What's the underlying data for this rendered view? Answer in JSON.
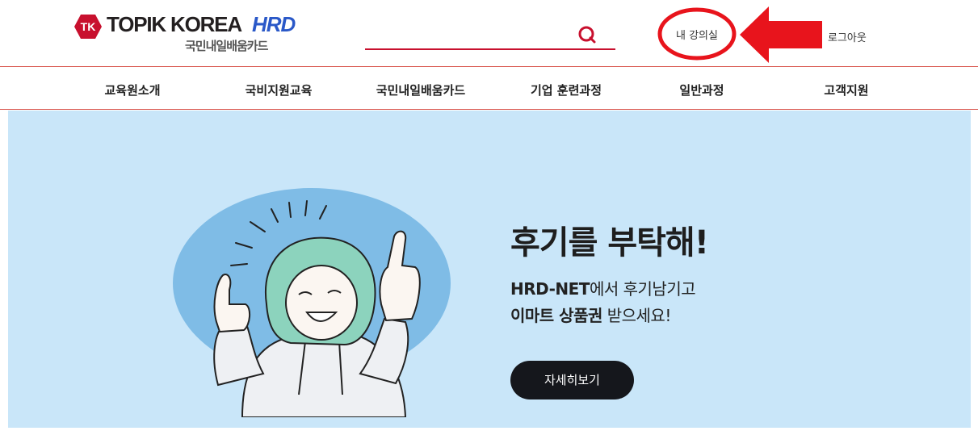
{
  "header": {
    "logo_badge": "TK",
    "logo_word": "TOPIK KOREA",
    "logo_hrd": "HRD",
    "logo_sub": "국민내일배움카드",
    "search": {
      "placeholder": "",
      "value": ""
    },
    "my_classroom": "내 강의실",
    "logout": "로그아웃"
  },
  "nav": {
    "items": [
      {
        "label": "교육원소개"
      },
      {
        "label": "국비지원교육"
      },
      {
        "label": "국민내일배움카드"
      },
      {
        "label": "기업 훈련과정"
      },
      {
        "label": "일반과정"
      },
      {
        "label": "고객지원"
      }
    ]
  },
  "banner": {
    "title": "후기를 부탁해!",
    "line1_bold": "HRD-NET",
    "line1_rest": "에서 후기남기고",
    "line2_bold": "이마트 상품권",
    "line2_rest": " 받으세요!",
    "button": "자세히보기"
  },
  "icons": {
    "search": "search-icon",
    "annotation_circle": "highlight-circle-icon",
    "annotation_arrow": "left-arrow-icon",
    "banner_art": "thumbs-up-person-illustration"
  },
  "colors": {
    "brand_red": "#c8102e",
    "hrd_blue": "#2a58c8",
    "divider": "#d9574f",
    "banner_bg": "#c9e6f9",
    "blob": "#7fbce6",
    "button_bg": "#15171c",
    "annotation_red": "#e8141c"
  }
}
